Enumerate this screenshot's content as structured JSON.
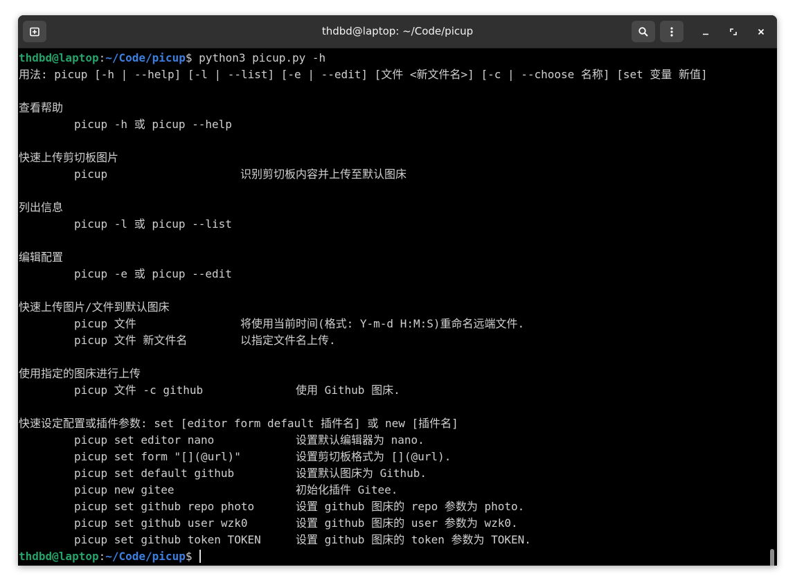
{
  "window": {
    "title": "thdbd@laptop: ~/Code/picup",
    "new_tab_icon": "new-tab-icon",
    "search_icon": "search-icon",
    "menu_icon": "hamburger-menu-icon",
    "minimize_icon": "minimize-icon",
    "maximize_icon": "maximize-icon",
    "close_icon": "close-icon"
  },
  "colors": {
    "terminal_bg": "#000000",
    "text": "#d0d0d0",
    "prompt_user": "#26a269",
    "prompt_path": "#3d7fe0",
    "titlebar": "#303030"
  },
  "prompt": {
    "user_host": "thdbd@laptop",
    "colon": ":",
    "path": "~/Code/picup",
    "symbol": "$"
  },
  "command": " python3 picup.py -h",
  "usage": "用法: picup [-h | --help] [-l | --list] [-e | --edit] [文件 <新文件名>] [-c | --choose 名称] [set 变量 新值]",
  "sections": {
    "help": {
      "heading": "查看帮助",
      "cmd": "picup -h 或 picup --help"
    },
    "clipboard": {
      "heading": "快速上传剪切板图片",
      "cmd": "picup",
      "desc": "识别剪切板内容并上传至默认图床"
    },
    "list": {
      "heading": "列出信息",
      "cmd": "picup -l 或 picup --list"
    },
    "edit": {
      "heading": "编辑配置",
      "cmd": "picup -e 或 picup --edit"
    },
    "upload": {
      "heading": "快速上传图片/文件到默认图床",
      "rows": [
        {
          "cmd": "picup 文件",
          "desc": "将使用当前时间(格式: Y-m-d H:M:S)重命名远端文件."
        },
        {
          "cmd": "picup 文件 新文件名",
          "desc": "以指定文件名上传."
        }
      ]
    },
    "choose": {
      "heading": "使用指定的图床进行上传",
      "rows": [
        {
          "cmd": "picup 文件 -c github",
          "desc": "使用 Github 图床."
        }
      ]
    },
    "set": {
      "heading": "快速设定配置或插件参数: set [editor form default 插件名] 或 new [插件名]",
      "rows": [
        {
          "cmd": "picup set editor nano",
          "desc": "设置默认编辑器为 nano."
        },
        {
          "cmd": "picup set form \"[](@url)\"",
          "desc": "设置剪切板格式为 [](@url)."
        },
        {
          "cmd": "picup set default github",
          "desc": "设置默认图床为 Github."
        },
        {
          "cmd": "picup new gitee",
          "desc": "初始化插件 Gitee."
        },
        {
          "cmd": "picup set github repo photo",
          "desc": "设置 github 图床的 repo 参数为 photo."
        },
        {
          "cmd": "picup set github user wzk0",
          "desc": "设置 github 图床的 user 参数为 wzk0."
        },
        {
          "cmd": "picup set github token TOKEN",
          "desc": "设置 github 图床的 token 参数为 TOKEN."
        }
      ]
    }
  }
}
